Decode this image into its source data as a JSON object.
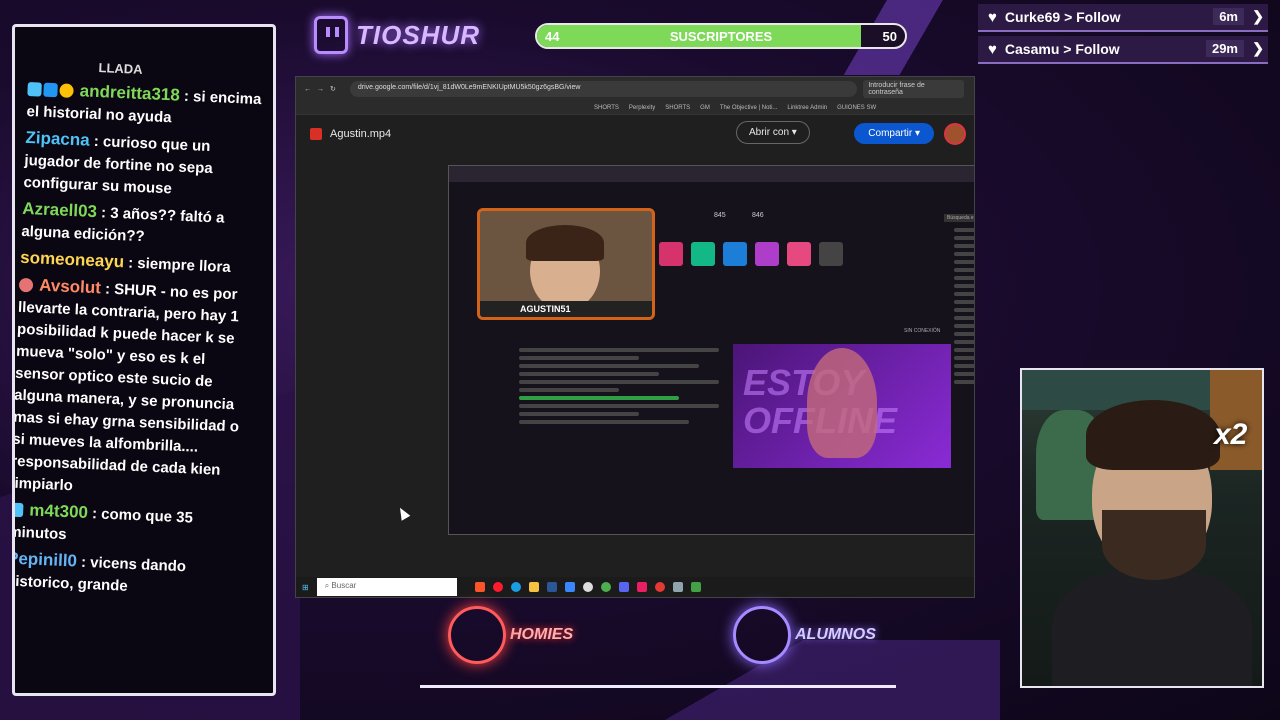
{
  "stream": {
    "channel_name": "TIOSHUR",
    "subs": {
      "label": "SUSCRIPTORES",
      "current": "44",
      "goal": "50",
      "progress": 0.88
    },
    "follows": [
      {
        "user": "Curke69",
        "action": "> Follow",
        "time": "6m"
      },
      {
        "user": "Casamu",
        "action": "> Follow",
        "time": "29m"
      }
    ],
    "bottom_logos": {
      "left": "HOMIES",
      "right": "ALUMNOS"
    },
    "cam_badge": "x2"
  },
  "chat": {
    "top_fragment": "LLADA",
    "messages": [
      {
        "user": "andreitta318",
        "user_color": "#7ed958",
        "text": ": si encima el historial no ayuda"
      },
      {
        "user": "Zipacna",
        "user_color": "#4fc3f7",
        "text": ": curioso que un jugador de fortine no sepa configurar su mouse"
      },
      {
        "user": "Azraell03",
        "user_color": "#7ed958",
        "text": ": 3 años?? faltó a alguna edición??"
      },
      {
        "user": "someoneayu",
        "user_color": "#ffd54f",
        "text": ": siempre llora"
      },
      {
        "user": "Avsolut",
        "user_color": "#ff8a65",
        "text": ": SHUR - no es por llevarte la contraria, pero hay 1 posibilidad k puede hacer k se mueva \"solo\" y eso es k el sensor optico este sucio de alguna manera, y se pronuncia mas si ehay grna sensibilidad o si mueves la alfombrilla.... responsabilidad de cada kien limpiarlo"
      },
      {
        "user": "m4t300",
        "user_color": "#7ed958",
        "text": ": como que 35 minutos"
      },
      {
        "user": "Pepinill0",
        "user_color": "#64b5f6",
        "text": ": vicens dando historico, grande"
      }
    ]
  },
  "browser": {
    "url": "drive.google.com/file/d/1vj_81dW0Le9mENKIUptMU5k50gz6gsBG/view",
    "bookmarks": [
      "SHORTS",
      "Perplexity",
      "SHORTS",
      "GM",
      "The Objective | Noti...",
      "Linktree Admin",
      "GUIONES SW"
    ],
    "password_hint": "Introducir frase de contraseña",
    "file_name": "Agustin.mp4",
    "open_with": "Abrir con",
    "share": "Compartir",
    "taskbar_search": "Buscar"
  },
  "inner_video": {
    "streamer_tag": "AGUSTIN51",
    "stat1": "845",
    "stat2": "846",
    "offline_text": "ESTOY OFFLINE",
    "status": "SIN CONEXIÓN",
    "search_label": "Búsqueda en Panel de control"
  }
}
